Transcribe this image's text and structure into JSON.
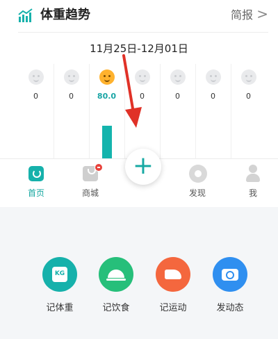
{
  "header": {
    "title": "体重趋势",
    "report_label": "简报",
    "chevron": ">"
  },
  "date_range": "11月25日-12月01日",
  "week": [
    {
      "value": "0",
      "active": false
    },
    {
      "value": "0",
      "active": false
    },
    {
      "value": "80.0",
      "active": true,
      "level": 0.9
    },
    {
      "value": "0",
      "active": false
    },
    {
      "value": "0",
      "active": false
    },
    {
      "value": "0",
      "active": false
    },
    {
      "value": "0",
      "active": false
    }
  ],
  "tabbar": {
    "home": "首页",
    "shop": "商城",
    "plus": "+",
    "discover": "发现",
    "me": "我"
  },
  "actions": {
    "record_weight": "记体重",
    "record_diet": "记饮食",
    "record_sport": "记运动",
    "post": "发动态",
    "kg_text": "KG"
  },
  "colors": {
    "accent": "#16b1ab",
    "diet": "#26bf7a",
    "sport": "#f4673e",
    "post": "#2f8ff0",
    "annotation_arrow": "#e03127",
    "badge": "#e8423b"
  }
}
